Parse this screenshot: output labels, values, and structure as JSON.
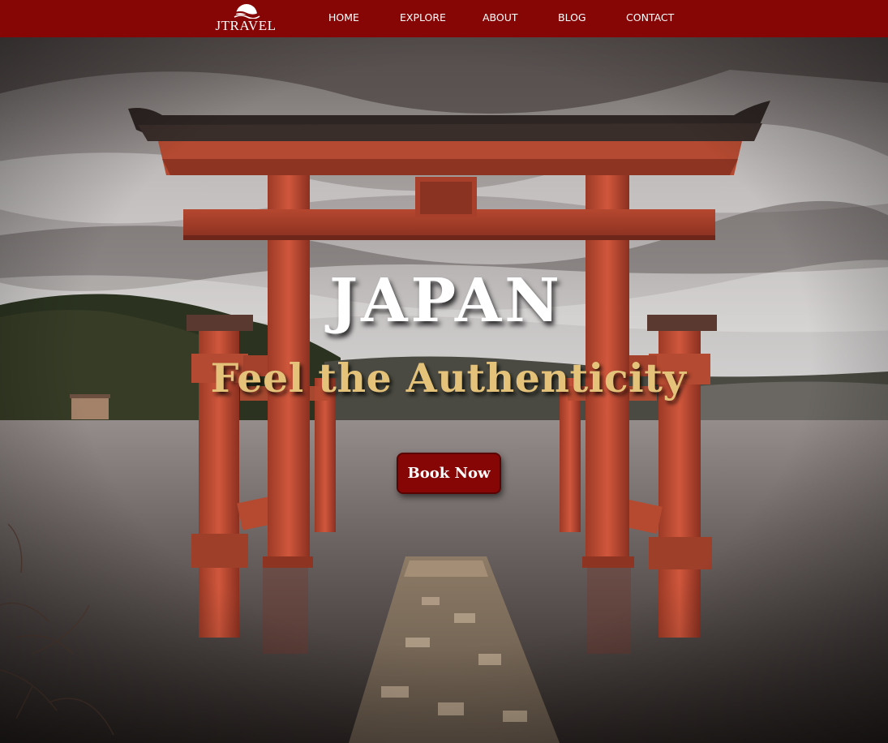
{
  "brand": {
    "name": "JTRAVEL",
    "color": "#860606"
  },
  "nav": {
    "items": [
      {
        "label": "HOME"
      },
      {
        "label": "EXPLORE"
      },
      {
        "label": "ABOUT"
      },
      {
        "label": "BLOG"
      },
      {
        "label": "CONTACT"
      }
    ]
  },
  "hero": {
    "title": "JAPAN",
    "subtitle": "Feel the Authenticity",
    "cta_label": "Book Now",
    "subtitle_color": "#e4c27a"
  }
}
